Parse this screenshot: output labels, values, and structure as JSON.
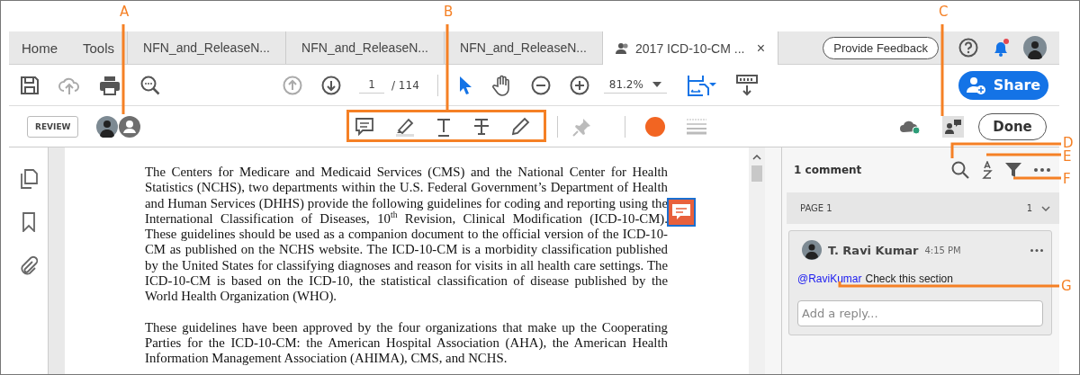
{
  "callouts": [
    {
      "label": "A"
    },
    {
      "label": "B"
    },
    {
      "label": "C"
    },
    {
      "label": "D"
    },
    {
      "label": "E"
    },
    {
      "label": "F"
    },
    {
      "label": "G"
    }
  ],
  "tabs": [
    {
      "label": "Home",
      "kind": "nav",
      "selected": false
    },
    {
      "label": "Tools",
      "kind": "nav",
      "selected": false
    },
    {
      "label": "NFN_and_ReleaseN...",
      "kind": "doc",
      "selected": false
    },
    {
      "label": "NFN_and_ReleaseN...",
      "kind": "doc",
      "selected": false
    },
    {
      "label": "NFN_and_ReleaseN...",
      "kind": "doc",
      "selected": false
    },
    {
      "label": "2017 ICD-10-CM ...",
      "kind": "shared",
      "selected": true,
      "close": "×"
    }
  ],
  "feedback_button": "Provide Feedback",
  "notifications": {
    "unread": true
  },
  "toolbar": {
    "page_current": "1",
    "page_total": "/ 114",
    "zoom": "81.2%",
    "share": "Share"
  },
  "review_bar": {
    "review": "REVIEW",
    "done": "Done"
  },
  "document": {
    "paragraphs": [
      "The Centers for Medicare and Medicaid Services (CMS) and the National Center for Health Statistics (NCHS), two departments within the U.S. Federal Government’s Department of Health and Human Services (DHHS) provide the following guidelines for coding and reporting using the International Classification of Diseases, 10$^{th}$ Revision, Clinical Modification (ICD-10-CM). These guidelines should be used as a companion document to the official version of the ICD-10-CM as published on the NCHS website. The ICD-10-CM is a morbidity classification published by the United States for classifying diagnoses and reason for visits in all health care settings.  The ICD-10-CM is based on the ICD-10, the statistical classification of disease published by the World Health Organization (WHO).",
      "These guidelines have been approved by the four organizations that make up the Cooperating Parties for the ICD-10-CM: the American Hospital Association (AHA), the American Health Information Management Association (AHIMA), CMS, and NCHS."
    ]
  },
  "comments_panel": {
    "count": "1 comment",
    "page_group": {
      "label": "PAGE 1",
      "count": "1"
    },
    "comment": {
      "author": "T. Ravi Kumar",
      "time": "4:15 PM",
      "mention": "@RaviKumar",
      "text": "Check this section"
    },
    "reply_placeholder": "Add a reply..."
  }
}
